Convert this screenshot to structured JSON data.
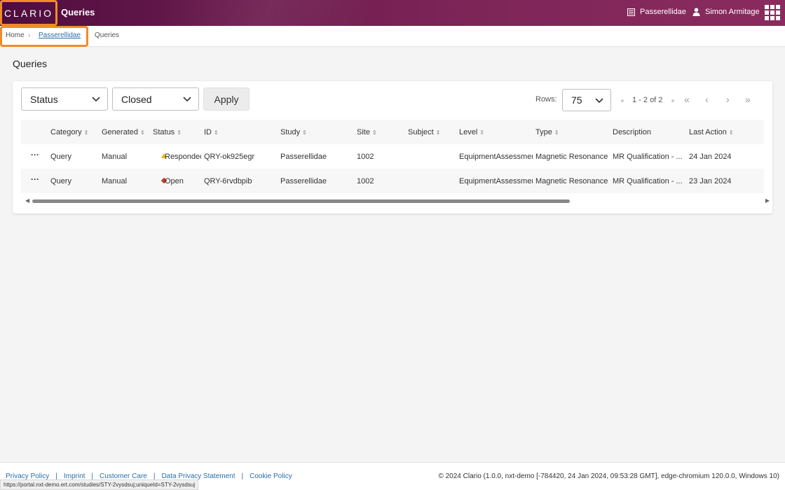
{
  "header": {
    "logo": "CLARIO",
    "title": "Queries",
    "study": "Passerellidae",
    "user": "Simon Armitage"
  },
  "breadcrumb": {
    "home": "Home",
    "study": "Passerellidae",
    "current": "Queries"
  },
  "page_title": "Queries",
  "filters": {
    "status_field": "Status",
    "status_value": "Closed",
    "apply": "Apply"
  },
  "pager": {
    "rows_label": "Rows:",
    "rows_value": "75",
    "range": "1 - 2 of 2"
  },
  "table": {
    "columns": [
      "Category",
      "Generated",
      "Status",
      "ID",
      "Study",
      "Site",
      "Subject",
      "Level",
      "Type",
      "Description",
      "Last Action"
    ],
    "rows": [
      {
        "category": "Query",
        "generated": "Manual",
        "status": "Responded",
        "id": "QRY-ok925egr",
        "study": "Passerellidae",
        "site": "1002",
        "subject": "",
        "level": "EquipmentAssessment",
        "type": "Magnetic Resonance",
        "description": "MR Qualification - ...",
        "last_action": "24 Jan 2024"
      },
      {
        "category": "Query",
        "generated": "Manual",
        "status": "Open",
        "id": "QRY-6rvdbpib",
        "study": "Passerellidae",
        "site": "1002",
        "subject": "",
        "level": "EquipmentAssessment",
        "type": "Magnetic Resonance",
        "description": "MR Qualification - ...",
        "last_action": "23 Jan 2024"
      }
    ]
  },
  "footer": {
    "links": [
      "Privacy Policy",
      "Imprint",
      "Customer Care",
      "Data Privacy Statement",
      "Cookie Policy"
    ],
    "copyright": "© 2024 Clario (1.0.0, nxt-demo [-784420, 24 Jan 2024, 09:53:28 GMT], edge-chromium 120.0.0, Windows 10)"
  },
  "status_url": "https://portal.nxt-demo.ert.com/studies/STY-2vysdsuj;uniqueId=STY-2vysdsuj",
  "colors": {
    "header_start": "#4e0d3d",
    "header_end": "#8a2b5e",
    "highlight": "#f08b2b",
    "link": "#2a6ea8",
    "status_responded": "#f0b400",
    "status_open": "#c0392b"
  }
}
